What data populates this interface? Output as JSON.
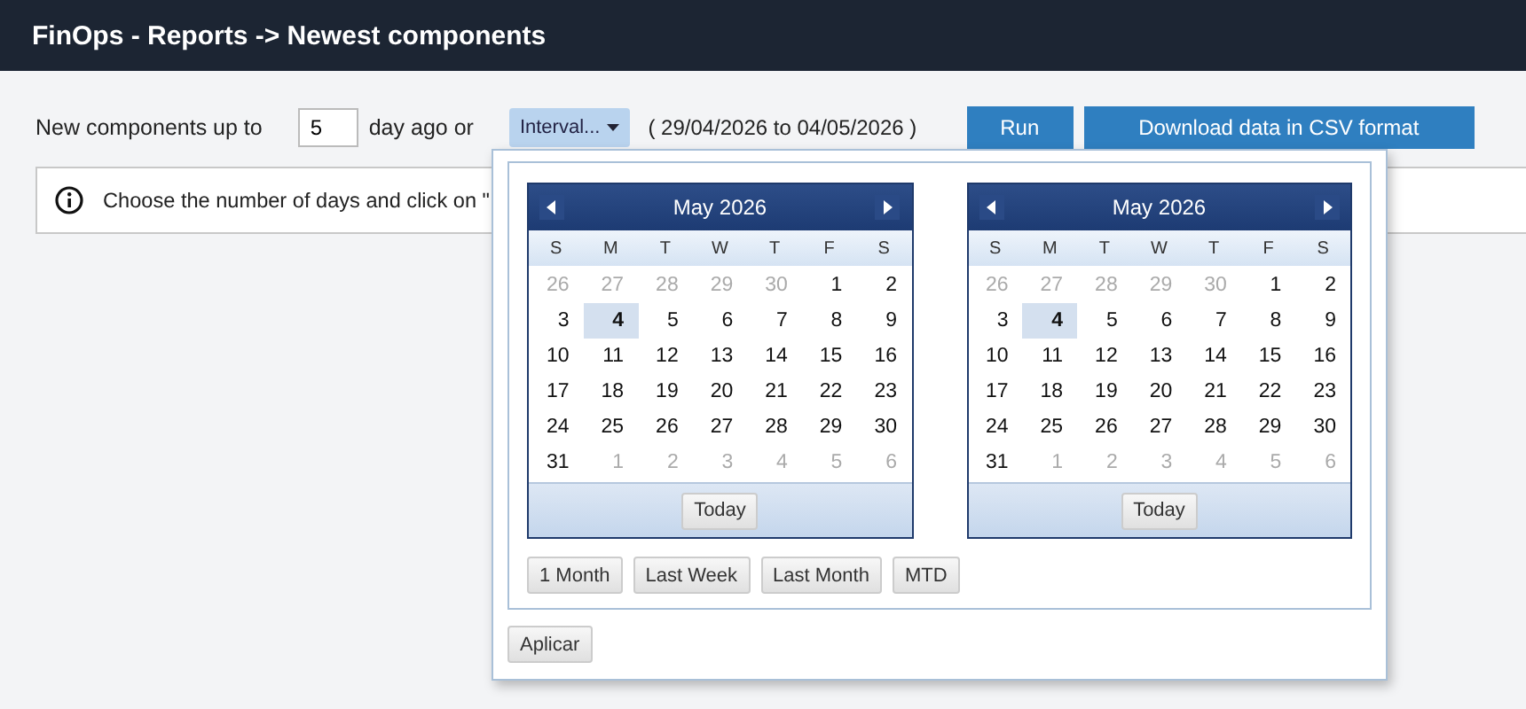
{
  "header": {
    "title": "FinOps - Reports -> Newest components"
  },
  "toolbar": {
    "label_before": "New components up to",
    "days_value": "5",
    "label_after": "day ago or",
    "interval_button": "Interval...",
    "range_text": "( 29/04/2026  to 04/05/2026 )",
    "run_button": "Run",
    "download_button": "Download data in CSV format"
  },
  "info": {
    "text": "Choose the number of days and click on \""
  },
  "popup": {
    "calendars": [
      {
        "title": "May 2026",
        "weekdays": [
          "S",
          "M",
          "T",
          "W",
          "T",
          "F",
          "S"
        ],
        "today_button": "Today",
        "weeks": [
          [
            {
              "day": "26",
              "other_month": true,
              "selected": false
            },
            {
              "day": "27",
              "other_month": true,
              "selected": false
            },
            {
              "day": "28",
              "other_month": true,
              "selected": false
            },
            {
              "day": "29",
              "other_month": true,
              "selected": false
            },
            {
              "day": "30",
              "other_month": true,
              "selected": false
            },
            {
              "day": "1",
              "other_month": false,
              "selected": false
            },
            {
              "day": "2",
              "other_month": false,
              "selected": false
            }
          ],
          [
            {
              "day": "3",
              "other_month": false,
              "selected": false
            },
            {
              "day": "4",
              "other_month": false,
              "selected": true
            },
            {
              "day": "5",
              "other_month": false,
              "selected": false
            },
            {
              "day": "6",
              "other_month": false,
              "selected": false
            },
            {
              "day": "7",
              "other_month": false,
              "selected": false
            },
            {
              "day": "8",
              "other_month": false,
              "selected": false
            },
            {
              "day": "9",
              "other_month": false,
              "selected": false
            }
          ],
          [
            {
              "day": "10",
              "other_month": false,
              "selected": false
            },
            {
              "day": "11",
              "other_month": false,
              "selected": false
            },
            {
              "day": "12",
              "other_month": false,
              "selected": false
            },
            {
              "day": "13",
              "other_month": false,
              "selected": false
            },
            {
              "day": "14",
              "other_month": false,
              "selected": false
            },
            {
              "day": "15",
              "other_month": false,
              "selected": false
            },
            {
              "day": "16",
              "other_month": false,
              "selected": false
            }
          ],
          [
            {
              "day": "17",
              "other_month": false,
              "selected": false
            },
            {
              "day": "18",
              "other_month": false,
              "selected": false
            },
            {
              "day": "19",
              "other_month": false,
              "selected": false
            },
            {
              "day": "20",
              "other_month": false,
              "selected": false
            },
            {
              "day": "21",
              "other_month": false,
              "selected": false
            },
            {
              "day": "22",
              "other_month": false,
              "selected": false
            },
            {
              "day": "23",
              "other_month": false,
              "selected": false
            }
          ],
          [
            {
              "day": "24",
              "other_month": false,
              "selected": false
            },
            {
              "day": "25",
              "other_month": false,
              "selected": false
            },
            {
              "day": "26",
              "other_month": false,
              "selected": false
            },
            {
              "day": "27",
              "other_month": false,
              "selected": false
            },
            {
              "day": "28",
              "other_month": false,
              "selected": false
            },
            {
              "day": "29",
              "other_month": false,
              "selected": false
            },
            {
              "day": "30",
              "other_month": false,
              "selected": false
            }
          ],
          [
            {
              "day": "31",
              "other_month": false,
              "selected": false
            },
            {
              "day": "1",
              "other_month": true,
              "selected": false
            },
            {
              "day": "2",
              "other_month": true,
              "selected": false
            },
            {
              "day": "3",
              "other_month": true,
              "selected": false
            },
            {
              "day": "4",
              "other_month": true,
              "selected": false
            },
            {
              "day": "5",
              "other_month": true,
              "selected": false
            },
            {
              "day": "6",
              "other_month": true,
              "selected": false
            }
          ]
        ]
      },
      {
        "title": "May 2026",
        "weekdays": [
          "S",
          "M",
          "T",
          "W",
          "T",
          "F",
          "S"
        ],
        "today_button": "Today",
        "weeks": [
          [
            {
              "day": "26",
              "other_month": true,
              "selected": false
            },
            {
              "day": "27",
              "other_month": true,
              "selected": false
            },
            {
              "day": "28",
              "other_month": true,
              "selected": false
            },
            {
              "day": "29",
              "other_month": true,
              "selected": false
            },
            {
              "day": "30",
              "other_month": true,
              "selected": false
            },
            {
              "day": "1",
              "other_month": false,
              "selected": false
            },
            {
              "day": "2",
              "other_month": false,
              "selected": false
            }
          ],
          [
            {
              "day": "3",
              "other_month": false,
              "selected": false
            },
            {
              "day": "4",
              "other_month": false,
              "selected": true
            },
            {
              "day": "5",
              "other_month": false,
              "selected": false
            },
            {
              "day": "6",
              "other_month": false,
              "selected": false
            },
            {
              "day": "7",
              "other_month": false,
              "selected": false
            },
            {
              "day": "8",
              "other_month": false,
              "selected": false
            },
            {
              "day": "9",
              "other_month": false,
              "selected": false
            }
          ],
          [
            {
              "day": "10",
              "other_month": false,
              "selected": false
            },
            {
              "day": "11",
              "other_month": false,
              "selected": false
            },
            {
              "day": "12",
              "other_month": false,
              "selected": false
            },
            {
              "day": "13",
              "other_month": false,
              "selected": false
            },
            {
              "day": "14",
              "other_month": false,
              "selected": false
            },
            {
              "day": "15",
              "other_month": false,
              "selected": false
            },
            {
              "day": "16",
              "other_month": false,
              "selected": false
            }
          ],
          [
            {
              "day": "17",
              "other_month": false,
              "selected": false
            },
            {
              "day": "18",
              "other_month": false,
              "selected": false
            },
            {
              "day": "19",
              "other_month": false,
              "selected": false
            },
            {
              "day": "20",
              "other_month": false,
              "selected": false
            },
            {
              "day": "21",
              "other_month": false,
              "selected": false
            },
            {
              "day": "22",
              "other_month": false,
              "selected": false
            },
            {
              "day": "23",
              "other_month": false,
              "selected": false
            }
          ],
          [
            {
              "day": "24",
              "other_month": false,
              "selected": false
            },
            {
              "day": "25",
              "other_month": false,
              "selected": false
            },
            {
              "day": "26",
              "other_month": false,
              "selected": false
            },
            {
              "day": "27",
              "other_month": false,
              "selected": false
            },
            {
              "day": "28",
              "other_month": false,
              "selected": false
            },
            {
              "day": "29",
              "other_month": false,
              "selected": false
            },
            {
              "day": "30",
              "other_month": false,
              "selected": false
            }
          ],
          [
            {
              "day": "31",
              "other_month": false,
              "selected": false
            },
            {
              "day": "1",
              "other_month": true,
              "selected": false
            },
            {
              "day": "2",
              "other_month": true,
              "selected": false
            },
            {
              "day": "3",
              "other_month": true,
              "selected": false
            },
            {
              "day": "4",
              "other_month": true,
              "selected": false
            },
            {
              "day": "5",
              "other_month": true,
              "selected": false
            },
            {
              "day": "6",
              "other_month": true,
              "selected": false
            }
          ]
        ]
      }
    ],
    "preset_buttons": [
      "1 Month",
      "Last Week",
      "Last Month",
      "MTD"
    ],
    "apply_button": "Aplicar"
  }
}
